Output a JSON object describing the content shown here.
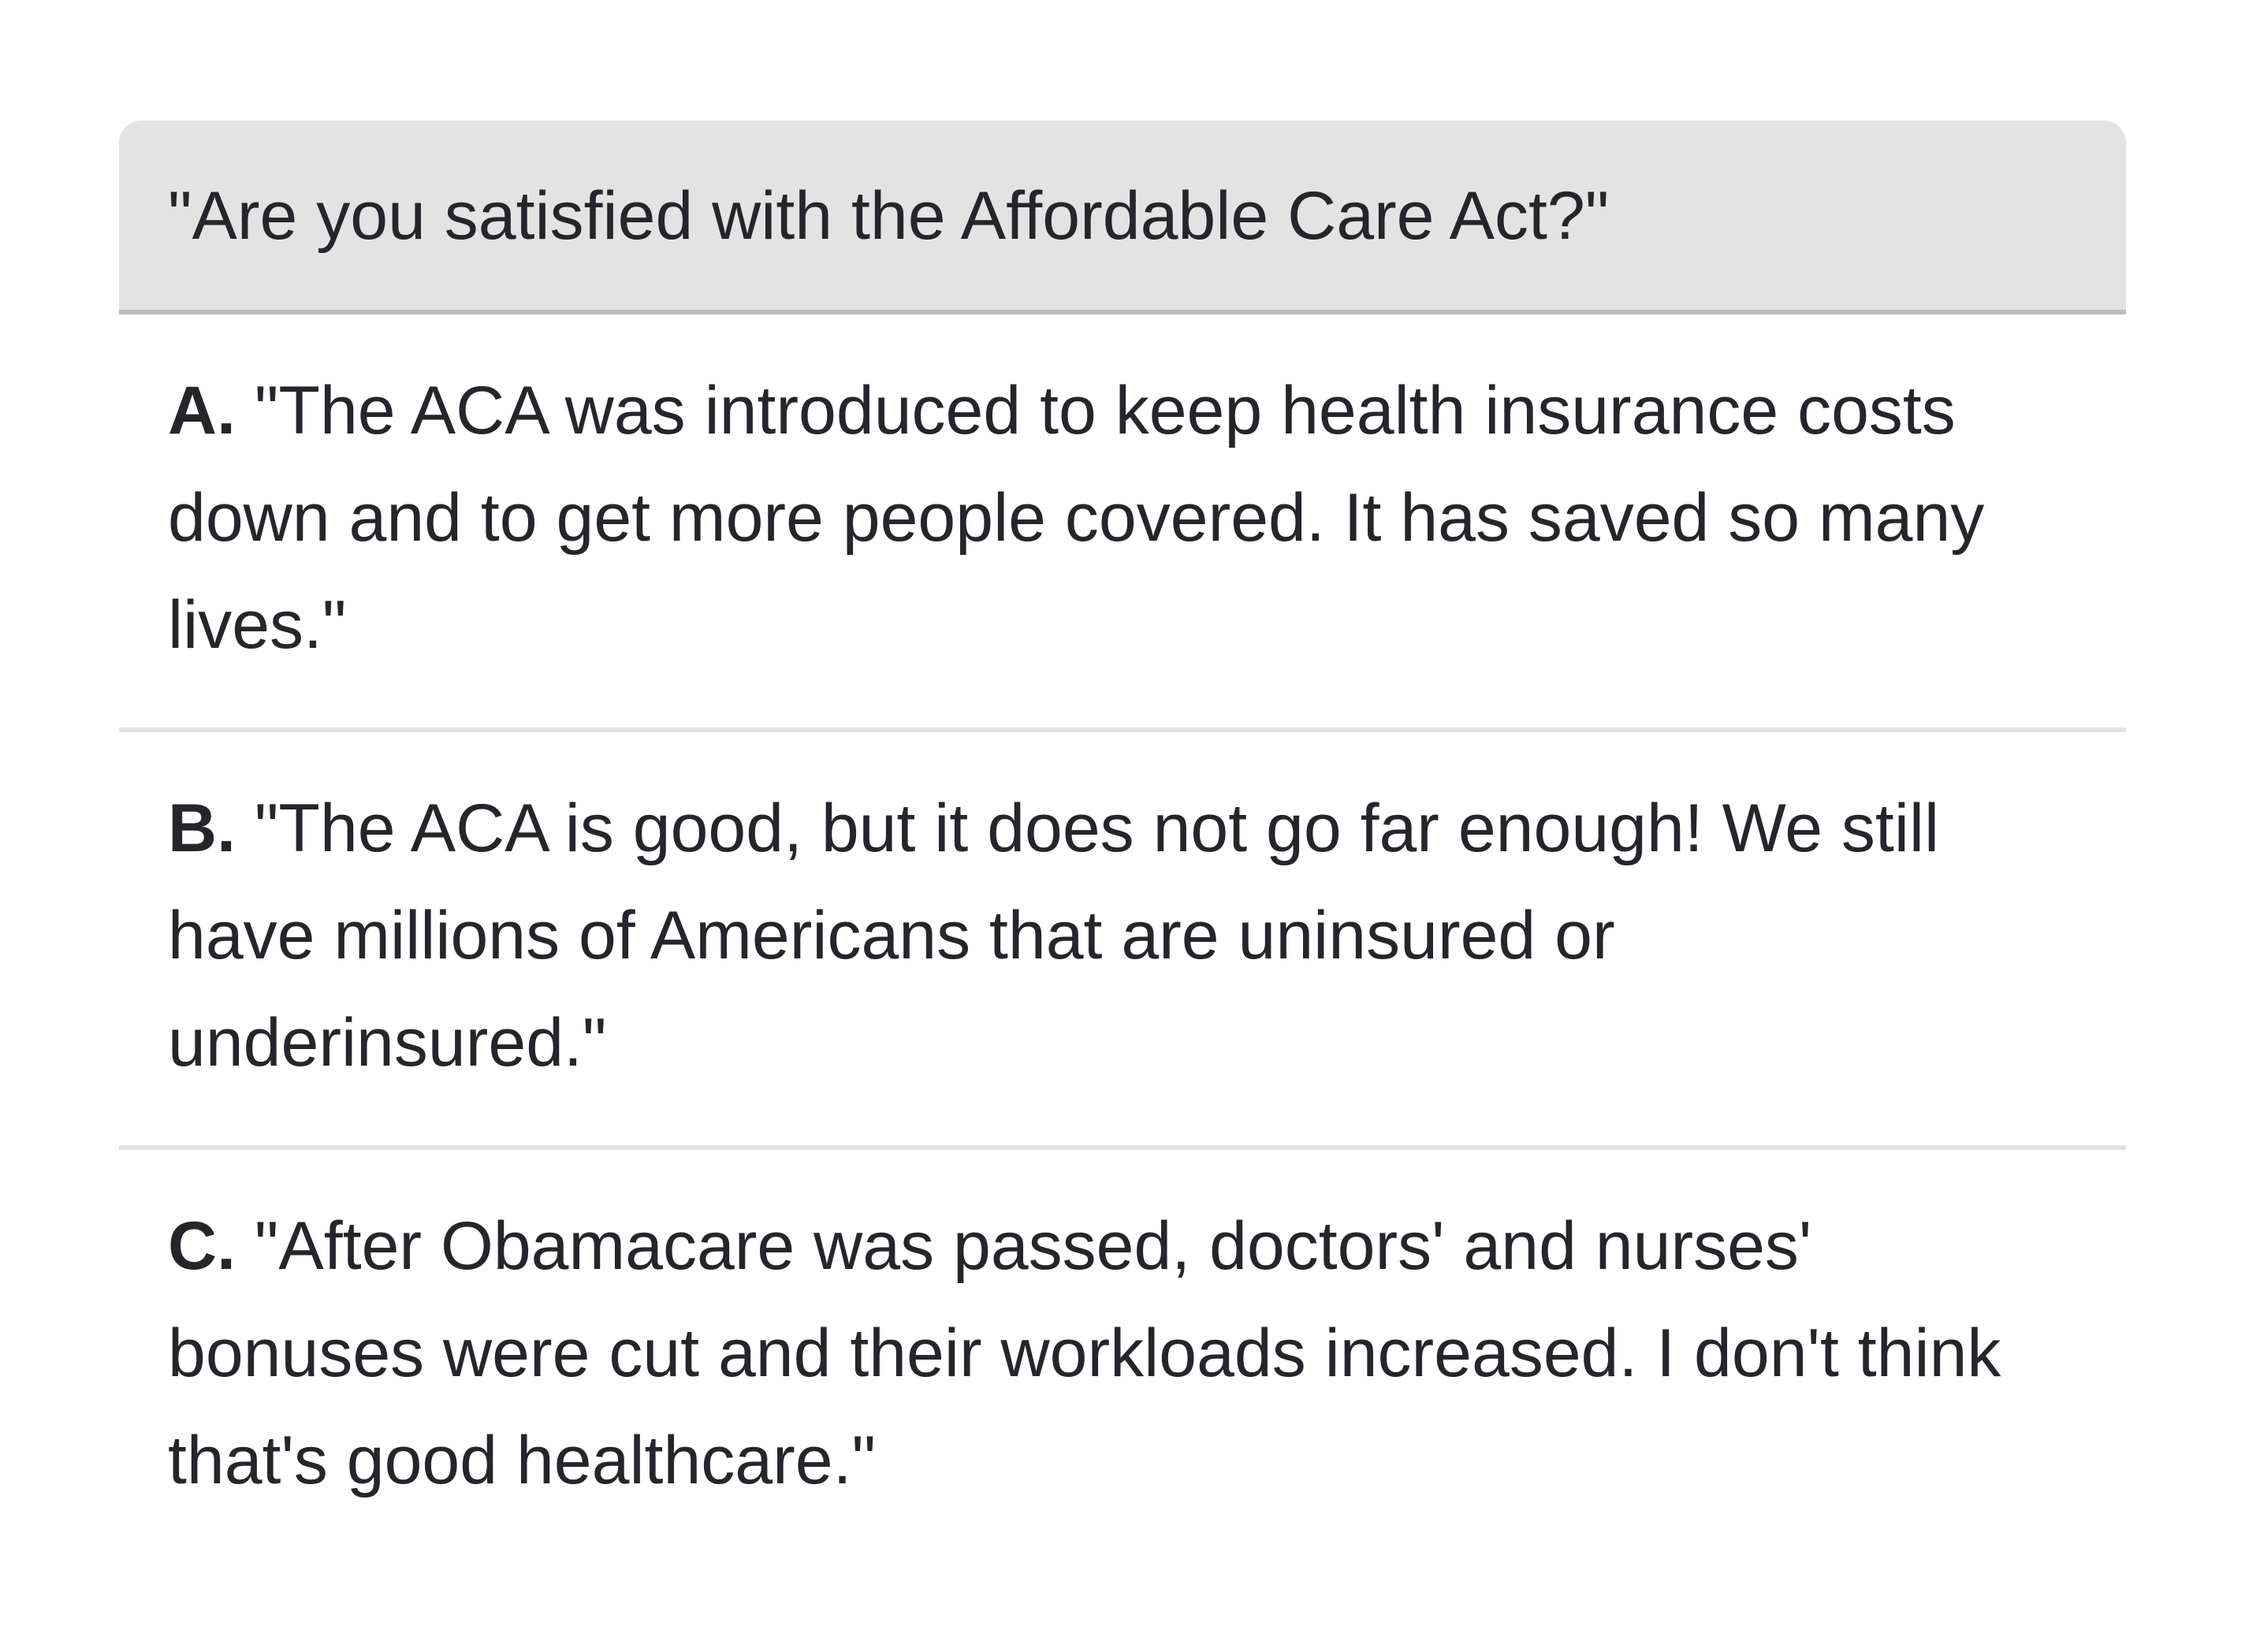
{
  "question": "\"Are you satisfied with the Affordable Care Act?\"",
  "options": [
    {
      "letter": "A.",
      "text": "\"The ACA was introduced to keep health insurance costs down and to get more people covered. It has saved so many lives.\""
    },
    {
      "letter": "B.",
      "text": "\"The ACA is good, but it does not go far enough! We still have millions of Americans that are uninsured or underinsured.\""
    },
    {
      "letter": "C.",
      "text": "\"After Obamacare was passed, doctors' and nurses' bonuses were cut and their workloads increased. I don't think that's good healthcare.\""
    }
  ]
}
